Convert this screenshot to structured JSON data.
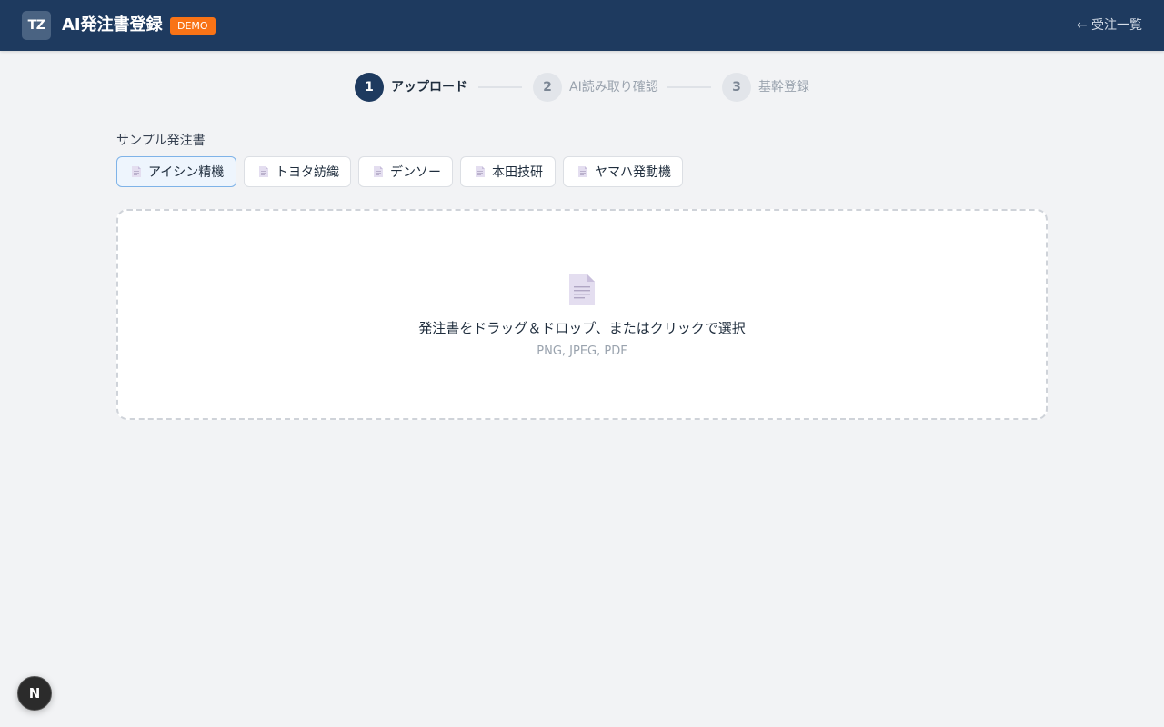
{
  "header": {
    "logo_text": "TZ",
    "title": "AI発注書登録",
    "badge": "DEMO",
    "back_link": "← 受注一覧"
  },
  "stepper": {
    "steps": [
      {
        "number": "1",
        "label": "アップロード",
        "state": "active"
      },
      {
        "number": "2",
        "label": "AI読み取り確認",
        "state": "inactive"
      },
      {
        "number": "3",
        "label": "基幹登録",
        "state": "inactive"
      }
    ]
  },
  "samples": {
    "title": "サンプル発注書",
    "selected_index": 0,
    "items": [
      {
        "label": "アイシン精機",
        "icon": "document-icon"
      },
      {
        "label": "トヨタ紡織",
        "icon": "document-icon"
      },
      {
        "label": "デンソー",
        "icon": "document-icon"
      },
      {
        "label": "本田技研",
        "icon": "document-icon"
      },
      {
        "label": "ヤマハ発動機",
        "icon": "document-icon"
      }
    ]
  },
  "dropzone": {
    "icon": "document-icon",
    "main_text": "発注書をドラッグ＆ドロップ、またはクリックで選択",
    "sub_text": "PNG, JPEG, PDF"
  },
  "next_badge": {
    "text": "N"
  },
  "colors": {
    "header_bg": "#1e3a5f",
    "badge_bg": "#f97316",
    "active_step": "#1e3a5f",
    "selected_sample_border": "#7fb3e8",
    "page_bg": "#f2f3f5"
  }
}
